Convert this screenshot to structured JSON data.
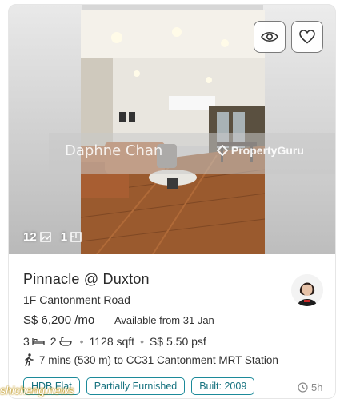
{
  "listing": {
    "title": "Pinnacle @ Duxton",
    "address": "1F Cantonment Road",
    "price": "S$ 6,200 /mo",
    "availability": "Available from 31 Jan",
    "bedrooms": "3",
    "bathrooms": "2",
    "area": "1128 sqft",
    "psf": "S$ 5.50 psf",
    "mrt": "7 mins (530 m) to CC31 Cantonment MRT Station",
    "tags": [
      "HDB Flat",
      "Partially Furnished",
      "Built: 2009"
    ],
    "posted": "5h"
  },
  "gallery": {
    "image_count": "12",
    "floorplan_count": "1",
    "watermark_agent": "Daphne Chan",
    "watermark_brand": "PropertyGuru"
  },
  "source_watermark": "shicheng.news",
  "icons": {
    "hide": "eye-icon",
    "favorite": "heart-icon",
    "images": "image-icon",
    "floorplan": "floorplan-icon",
    "bed": "bed-icon",
    "bath": "bath-icon",
    "walk": "walking-icon",
    "clock": "clock-icon"
  },
  "colors": {
    "tag_border": "#1c8a9a",
    "tag_text": "#16727f",
    "floor": "#9a5a2e",
    "sofa": "#b86a3a"
  }
}
